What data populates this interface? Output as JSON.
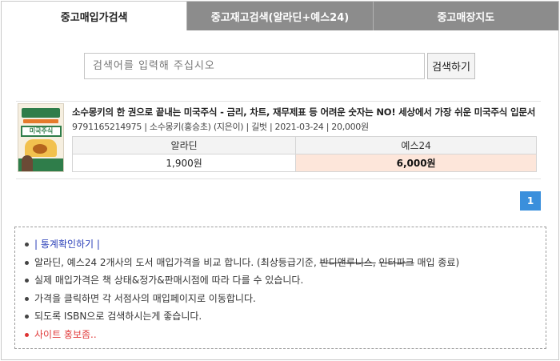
{
  "tabs": [
    {
      "label": "중고매입가검색",
      "active": true
    },
    {
      "label": "중고재고검색(알라딘+예스24)",
      "active": false
    },
    {
      "label": "중고매장지도",
      "active": false
    }
  ],
  "search": {
    "placeholder": "검색어를 입력해 주십시오",
    "value": "",
    "button_label": "검색하기"
  },
  "book": {
    "title": "소수몽키의 한 권으로 끝내는 미국주식 - 금리, 차트, 재무제표 등 어려운 숫자는 NO! 세상에서 가장 쉬운 미국주식 입문서",
    "isbn": "9791165214975",
    "author": "소수몽키(홍승초) (지은이)",
    "publisher": "길벗",
    "date": "2021-03-24",
    "list_price": "20,000원",
    "cover": {
      "top_text": "소수몽키의 한 권으로 끝내는",
      "main_text": "미국주식"
    }
  },
  "prices": {
    "headers": [
      "알라딘",
      "예스24"
    ],
    "values": [
      "1,900원",
      "6,000원"
    ]
  },
  "pagination": {
    "current": "1"
  },
  "notice": {
    "stats_link": "| 통계확인하기 |",
    "line2_prefix": "알라딘, 예스24 2개사의 도서 매입가격을 비교 합니다. (최상등급기준, ",
    "line2_strike1": "반디앤루니스,",
    "line2_space": " ",
    "line2_strike2": "인터파크",
    "line2_suffix": " 매입 종료)",
    "line3": "실제 매입가격은 책 상태&정가&판매시점에 따라 다를 수 있습니다.",
    "line4": "가격을 클릭하면 각 서점사의 매입페이지로 이동합니다.",
    "line5": "되도록 ISBN으로 검색하시는게 좋습니다.",
    "promo_link": "사이트 홍보좀.."
  },
  "colors": {
    "tab_inactive": "#8c8c8c",
    "highlight_price": "#fde6da",
    "pager_active": "#3a8fdc",
    "link_blue": "#2a3fb8",
    "link_red": "#e03a3a"
  }
}
